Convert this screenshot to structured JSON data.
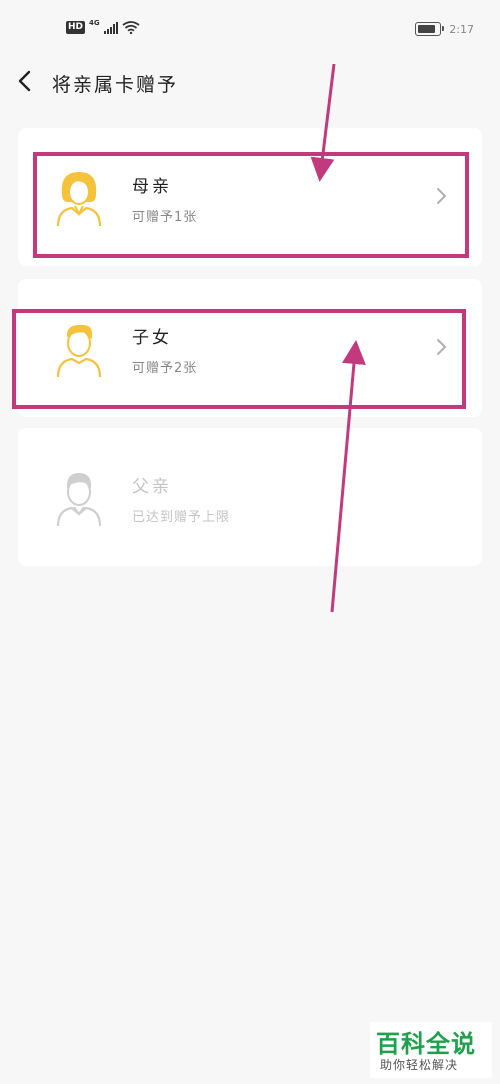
{
  "status_bar": {
    "hd": "HD",
    "network": "4G",
    "time": "2:17",
    "battery_level": 0.85
  },
  "header": {
    "title": "将亲属卡赠予"
  },
  "recipients": [
    {
      "label": "母亲",
      "sub": "可赠予1张",
      "enabled": true,
      "avatar": "female-avatar-icon",
      "avatar_color": "#f5c33b"
    },
    {
      "label": "子女",
      "sub": "可赠予2张",
      "enabled": true,
      "avatar": "child-avatar-icon",
      "avatar_color": "#f5c33b"
    },
    {
      "label": "父亲",
      "sub": "已达到赠予上限",
      "enabled": false,
      "avatar": "male-avatar-icon",
      "avatar_color": "#cfcfcf"
    }
  ],
  "colors": {
    "annotation": "#c23a7d",
    "accent": "#f5c33b",
    "watermark": "#1ea14a"
  },
  "watermark": {
    "title": "百科全说",
    "subtitle": "助你轻松解决"
  }
}
